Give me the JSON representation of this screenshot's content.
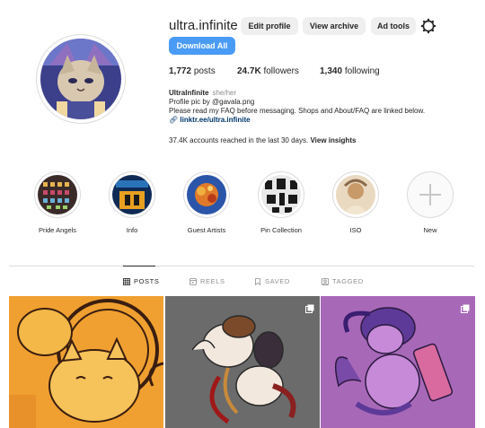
{
  "profile": {
    "username": "ultra.infinite",
    "buttons": {
      "edit": "Edit profile",
      "archive": "View archive",
      "adtools": "Ad tools",
      "download": "Download All"
    },
    "stats": {
      "posts_count": "1,772",
      "posts_label": "posts",
      "followers_count": "24.7K",
      "followers_label": "followers",
      "following_count": "1,340",
      "following_label": "following"
    },
    "bio": {
      "name": "UltraInfinite",
      "pronouns": "she/her",
      "line1": "Profile pic by @gavala.png",
      "line2": "Please read my FAQ before messaging. Shops and About/FAQ are linked below.",
      "link": "linktr.ee/ultra.infinite"
    },
    "reach": {
      "text": "37.4K accounts reached in the last 30 days.",
      "action": "View insights"
    }
  },
  "highlights": [
    {
      "label": "Pride Angels"
    },
    {
      "label": "Info"
    },
    {
      "label": "Guest Artists"
    },
    {
      "label": "Pin Collection"
    },
    {
      "label": "ISO"
    },
    {
      "label": "New"
    }
  ],
  "tabs": [
    {
      "label": "POSTS",
      "active": true
    },
    {
      "label": "REELS",
      "active": false
    },
    {
      "label": "SAVED",
      "active": false
    },
    {
      "label": "TAGGED",
      "active": false
    }
  ],
  "colors": {
    "accent": "#4a9bf5",
    "link": "#00376b",
    "muted": "#8e8e8e",
    "button_bg": "#efefef"
  }
}
